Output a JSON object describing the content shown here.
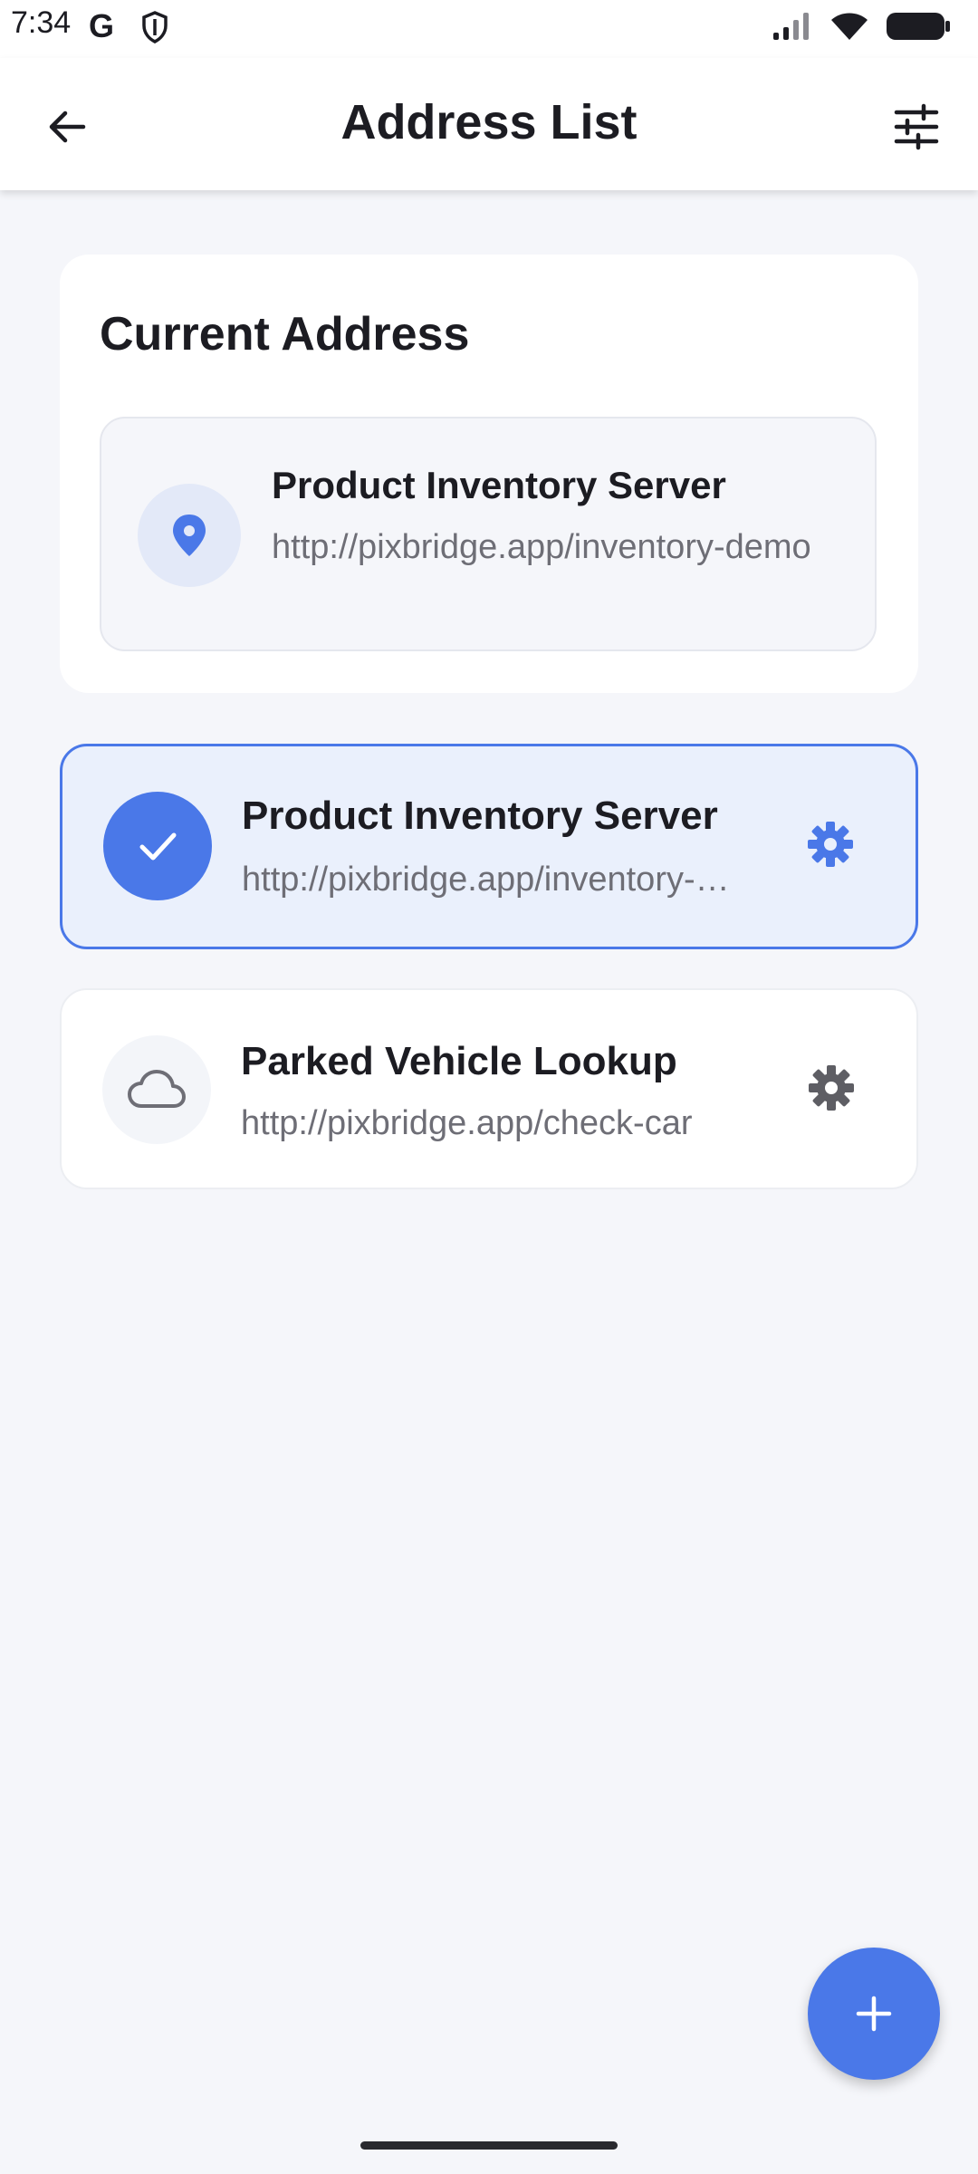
{
  "status_bar": {
    "time": "7:34",
    "g_label": "G"
  },
  "app_bar": {
    "title": "Address List"
  },
  "current_section": {
    "title": "Current Address",
    "name": "Product Inventory Server",
    "url": "http://pixbridge.app/inventory-demo"
  },
  "addresses": [
    {
      "name": "Product Inventory Server",
      "url": "http://pixbridge.app/inventory-demo",
      "selected": true
    },
    {
      "name": "Parked Vehicle Lookup",
      "url": "http://pixbridge.app/check-car",
      "selected": false
    }
  ],
  "colors": {
    "accent": "#4A78E8",
    "selected_bg": "#EAF0FC",
    "background": "#F5F6FA",
    "muted_text": "#6E6E76"
  },
  "icons": {
    "back": "arrow-left-icon",
    "filter": "sliders-icon",
    "pin": "location-pin-icon",
    "check": "check-icon",
    "cloud": "cloud-icon",
    "gear": "gear-icon",
    "add": "plus-icon"
  }
}
